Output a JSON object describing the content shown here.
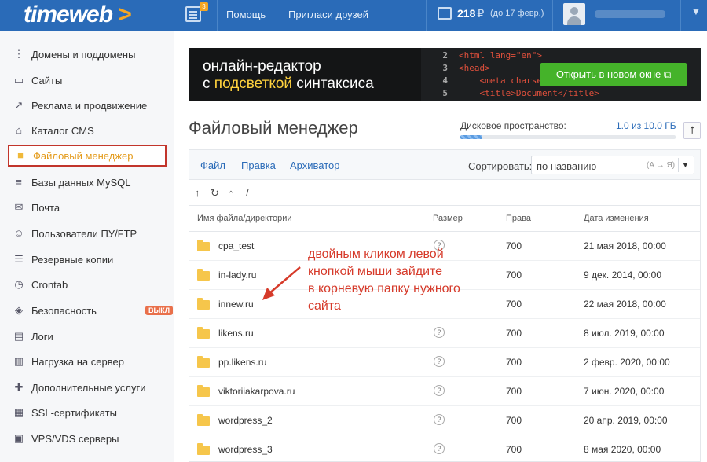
{
  "topbar": {
    "logo_text": "timeweb",
    "logo_arrow": ">",
    "messages_count": "3",
    "help": "Помощь",
    "invite": "Пригласи друзей",
    "balance": "218",
    "currency": "₽",
    "balance_until": "(до 17 февр.)",
    "menu_caret": "▼"
  },
  "sidebar": {
    "items": [
      {
        "label": "Домены и поддомены",
        "icon": "domains-icon"
      },
      {
        "label": "Сайты",
        "icon": "sites-icon"
      },
      {
        "label": "Реклама и продвижение",
        "icon": "ads-icon"
      },
      {
        "label": "Каталог CMS",
        "icon": "cms-icon"
      },
      {
        "label": "Файловый менеджер",
        "icon": "folder-icon"
      },
      {
        "label": "Базы данных MySQL",
        "icon": "database-icon"
      },
      {
        "label": "Почта",
        "icon": "mail-icon"
      },
      {
        "label": "Пользователи ПУ/FTP",
        "icon": "users-icon"
      },
      {
        "label": "Резервные копии",
        "icon": "backup-icon"
      },
      {
        "label": "Crontab",
        "icon": "clock-icon"
      },
      {
        "label": "Безопасность",
        "icon": "shield-icon",
        "badge": "ВЫКЛ"
      },
      {
        "label": "Логи",
        "icon": "logs-icon"
      },
      {
        "label": "Нагрузка на сервер",
        "icon": "load-icon"
      },
      {
        "label": "Дополнительные услуги",
        "icon": "extras-icon"
      },
      {
        "label": "SSL-сертификаты",
        "icon": "ssl-icon"
      },
      {
        "label": "VPS/VDS серверы",
        "icon": "server-icon"
      }
    ]
  },
  "banner": {
    "title_line1": "онлайн-редактор",
    "title_line2_pre": "с ",
    "title_line2_hl": "подсветкой",
    "title_line2_post": " синтаксиса",
    "button": "Открыть в новом окне",
    "code_lines": [
      {
        "num": "2",
        "code": "<html lang=\"en\">"
      },
      {
        "num": "3",
        "code": "<head>"
      },
      {
        "num": "4",
        "code": "<meta charset"
      },
      {
        "num": "5",
        "code": "<title>Document</title>"
      }
    ]
  },
  "page": {
    "title": "Файловый менеджер",
    "disk_label": "Дисковое пространство:",
    "disk_value": "1.0 из 10.0 ГБ",
    "disk_used_fraction": 0.1
  },
  "toolbar": {
    "file": "Файл",
    "edit": "Правка",
    "archiver": "Архиватор",
    "sort_label": "Сортировать:",
    "sort_value": "по названию",
    "sort_hint": "(А → Я)",
    "path": "/"
  },
  "table": {
    "headers": {
      "name": "Имя файла/директории",
      "size": "Размер",
      "perm": "Права",
      "date": "Дата изменения"
    },
    "rows": [
      {
        "name": "cpa_test",
        "perm": "700",
        "date": "21 мая 2018, 00:00"
      },
      {
        "name": "in-lady.ru",
        "perm": "700",
        "date": "9 дек. 2014, 00:00"
      },
      {
        "name": "innew.ru",
        "perm": "700",
        "date": "22 мая 2018, 00:00"
      },
      {
        "name": "likens.ru",
        "perm": "700",
        "date": "8 июл. 2019, 00:00"
      },
      {
        "name": "pp.likens.ru",
        "perm": "700",
        "date": "2 февр. 2020, 00:00"
      },
      {
        "name": "viktoriiakarpova.ru",
        "perm": "700",
        "date": "7 июн. 2020, 00:00"
      },
      {
        "name": "wordpress_2",
        "perm": "700",
        "date": "20 апр. 2019, 00:00"
      },
      {
        "name": "wordpress_3",
        "perm": "700",
        "date": "8 мая 2020, 00:00"
      }
    ],
    "size_placeholder": "?"
  },
  "annotation": {
    "lines": [
      "двойным кликом левой",
      "кнопкой мыши зайдите",
      "в корневую папку нужного",
      "сайта"
    ]
  },
  "colors": {
    "brand": "#2a6bb8",
    "accent": "#f5a623",
    "annotation": "#d63a2a",
    "button_green": "#45b32a"
  }
}
